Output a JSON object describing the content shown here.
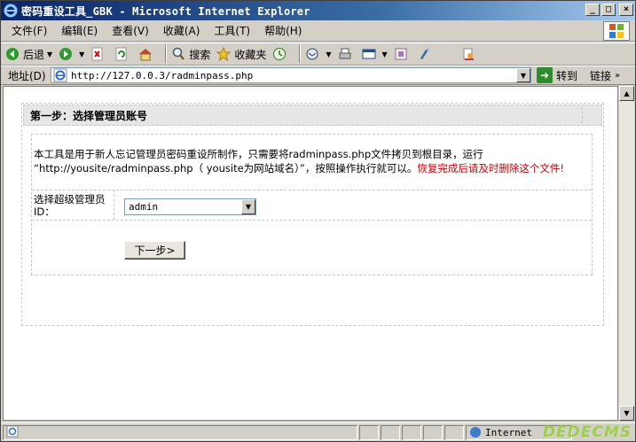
{
  "window": {
    "title": "密码重设工具_GBK - Microsoft Internet Explorer",
    "buttons": {
      "minimize": "_",
      "maximize": "□",
      "close": "×"
    }
  },
  "menu": {
    "items": [
      "文件(F)",
      "编辑(E)",
      "查看(V)",
      "收藏(A)",
      "工具(T)",
      "帮助(H)"
    ]
  },
  "toolbar": {
    "back_label": "后退",
    "search_label": "搜索",
    "favorites_label": "收藏夹"
  },
  "addressbar": {
    "label": "地址(D)",
    "url": "http://127.0.0.3/radminpass.php",
    "go_label": "转到",
    "links_label": "链接"
  },
  "page": {
    "step_title": "第一步：选择管理员账号",
    "description_line1": "本工具是用于新人忘记管理员密码重设所制作，只需要将radminpass.php文件拷贝到根目录，运行",
    "description_line2": "“http://yousite/radminpass.php（ yousite为网站域名）”，按照操作执行就可以。",
    "description_warning": "恢复完成后请及时删除这个文件!",
    "admin_label": "选择超级管理员ID：",
    "admin_selected": "admin",
    "next_button": "下一步>"
  },
  "status": {
    "zone": "Internet"
  },
  "watermark": {
    "text": "DEDECMS"
  },
  "colors": {
    "titlebar": "#0a246a",
    "warning": "#d00000",
    "watermark": "#9cd04a"
  }
}
